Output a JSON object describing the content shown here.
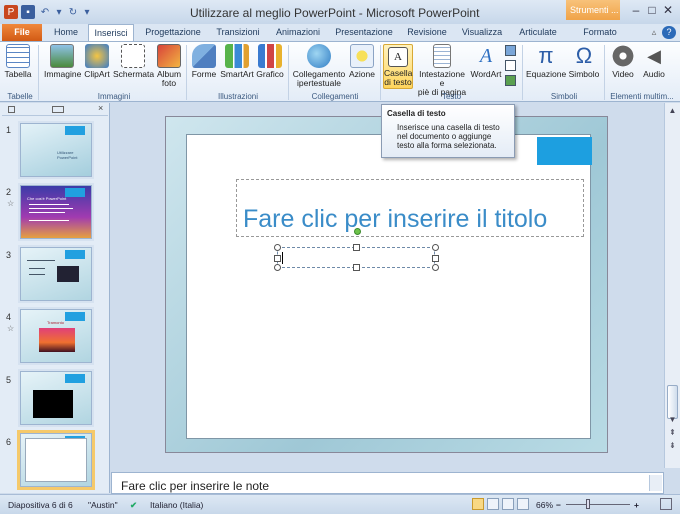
{
  "window": {
    "title": "Utilizzare al meglio PowerPoint - Microsoft PowerPoint",
    "context_tab": "Strumenti ..."
  },
  "tabs": [
    "File",
    "Home",
    "Inserisci",
    "Progettazione",
    "Transizioni",
    "Animazioni",
    "Presentazione",
    "Revisione",
    "Visualizza",
    "Articulate",
    "Formato"
  ],
  "ribbon": {
    "buttons": {
      "tabella": "Tabella",
      "immagine": "Immagine",
      "clipart": "ClipArt",
      "schermata": "Schermata",
      "album": "Album",
      "album2": "foto",
      "forme": "Forme",
      "smartart": "SmartArt",
      "grafico": "Grafico",
      "collegamento": "Collegamento",
      "collegamento2": "ipertestuale",
      "azione": "Azione",
      "casella": "Casella",
      "casella2": "di testo",
      "intestazione": "Intestazione e",
      "intestazione2": "piè di pagina",
      "wordart": "WordArt",
      "equazione": "Equazione",
      "simbolo": "Simbolo",
      "video": "Video",
      "audio": "Audio"
    },
    "groups": {
      "tabelle": "Tabelle",
      "immagini": "Immagini",
      "illustrazioni": "Illustrazioni",
      "collegamenti": "Collegamenti",
      "testo": "Testo",
      "simboli": "Simboli",
      "elementi": "Elementi multim..."
    }
  },
  "tooltip": {
    "title": "Casella di testo",
    "body": "Inserisce una casella di testo nel documento o aggiunge testo alla forma selezionata."
  },
  "slides": [
    {
      "num": "1",
      "caption": "Utilizzare PowerPoint"
    },
    {
      "num": "2",
      "caption": "Che cos'è PowerPoint"
    },
    {
      "num": "3",
      "caption": ""
    },
    {
      "num": "4",
      "caption": "Tramonto"
    },
    {
      "num": "5",
      "caption": ""
    },
    {
      "num": "6",
      "caption": ""
    }
  ],
  "slide": {
    "title_placeholder": "Fare clic per inserire il titolo"
  },
  "notes": {
    "placeholder": "Fare clic per inserire le note"
  },
  "status": {
    "slide_counter": "Diapositiva 6 di 6",
    "theme": "\"Austin\"",
    "language": "Italiano (Italia)",
    "zoom": "66%"
  },
  "colors": {
    "accent_blue": "#1d9fe0",
    "file_tab": "#d25a14",
    "context_tab": "#f0a348",
    "title_text": "#3a8cc8"
  }
}
